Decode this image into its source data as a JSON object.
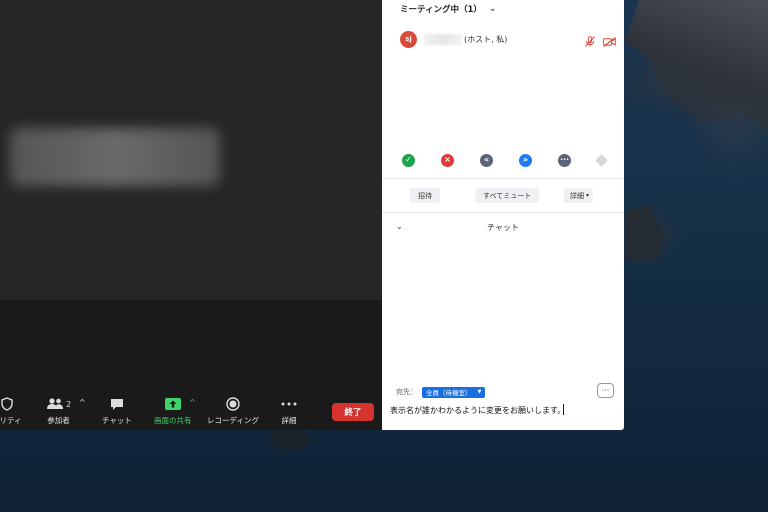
{
  "panel": {
    "title": "ミーティング中（1）",
    "participant": {
      "initials": "sj",
      "role": "(ホスト, 私)"
    },
    "actions": {
      "invite": "招待",
      "mute_all": "すべてミュート",
      "more": "詳細"
    }
  },
  "chat": {
    "title": "チャット",
    "to_label": "宛先：",
    "to_value": "全員（待機室）",
    "input_value": "表示名が誰かわかるように変更をお願いします。"
  },
  "toolbar": {
    "security": "ュリティ",
    "participants": "参加者",
    "participant_count": "2",
    "chat": "チャット",
    "share": "画面の共有",
    "record": "レコーディング",
    "more": "詳細",
    "end": "終了"
  },
  "colors": {
    "end_red": "#d6322e",
    "share_green": "#3fd46a",
    "to_blue": "#1a6fe0",
    "avatar_red": "#d94a3d"
  }
}
